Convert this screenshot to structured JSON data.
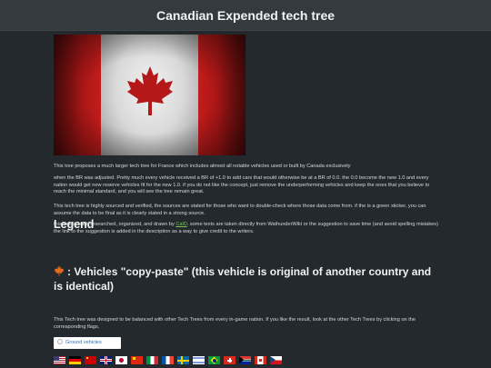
{
  "header": {
    "title": "Canadian Expended tech tree"
  },
  "image": {
    "icon": "maple-leaf-icon",
    "colors": {
      "red": "#c11c1c",
      "white": "#f2f2f2"
    }
  },
  "intro": {
    "p1": "This tree proposes a much larger tech tree for France which includes almost all notable vehicles used or built by Canada exclusively",
    "p2": "when the BR was adjusted. Pretty much every vehicle received a BR of +1.0 to add cars that would otherwise be at a BR of 0.0. the 0.0 become the new 1.0 and every nation would get new reserve vehicles fit for the new 1.0. if you do not like the concept, just remove the underperforming vehicles and keep the ones that you believe to reach the minimal standard, and you will see the tree remain great.",
    "p3": "This tech tree is highly sourced and verified, the sources are stated for those who want to double-check where those data come from. if the is a green sticker, you can assume the data to be final as it is clearly stated in a strong source.",
    "p4_before": "this tree is built, researched, organized, and drawn by ",
    "p4_link": "CalD",
    "p4_after": ". some texts are taken directly from WathunderWiki or the suggestion to save time (and avoid spelling mistakes) the link to the suggestion is added in the description as a way to give credit to the writers."
  },
  "legend": {
    "heading": "Legend",
    "item_text": ": Vehicles \"copy-paste\" (this vehicle is original of another country and is identical)"
  },
  "balance_text": "This Tech tree was designed to be balanced with other Tech Trees from every in-game nation. If you like the result, look at the other Tech Trees by clicking on the corresponding flags.",
  "ground_button": {
    "label": "Ground vehicles"
  },
  "nations": [
    "usa-flag",
    "germany-flag",
    "ussr-flag",
    "uk-flag",
    "japan-flag",
    "china-flag",
    "italy-flag",
    "france-flag",
    "sweden-flag",
    "israel-flag",
    "brazil-flag",
    "switzerland-flag",
    "south-africa-flag",
    "canada-flag",
    "czech-flag"
  ]
}
